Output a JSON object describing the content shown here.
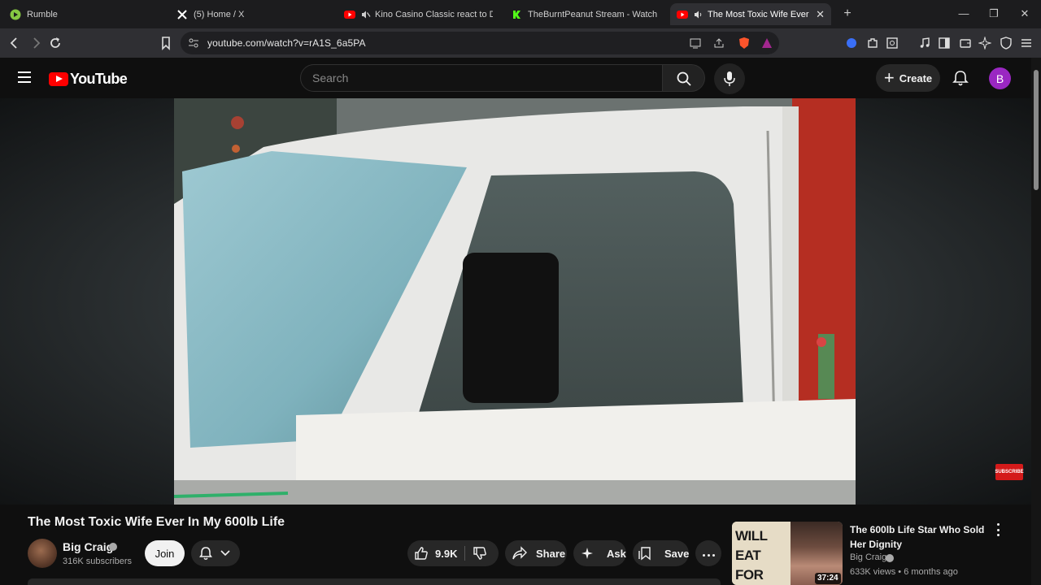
{
  "browser": {
    "tabs": [
      {
        "label": "Rumble",
        "active": false
      },
      {
        "label": "(5) Home / X",
        "active": false
      },
      {
        "label": "Kino Casino Classic react to DSPG",
        "active": false
      },
      {
        "label": "TheBurntPeanut Stream - Watch Live",
        "active": false
      },
      {
        "label": "The Most Toxic Wife Ever In My",
        "active": true
      }
    ],
    "url": "youtube.com/watch?v=rA1S_6a5PA"
  },
  "youtube": {
    "logo_text": "YouTube",
    "search_placeholder": "Search",
    "create_label": "Create",
    "avatar_letter": "B"
  },
  "video": {
    "title": "The Most Toxic Wife Ever In My 600lb Life",
    "channel_name": "Big Craig",
    "subscribers": "316K subscribers",
    "join_label": "Join",
    "likes": "9.9K",
    "share_label": "Share",
    "ask_label": "Ask",
    "save_label": "Save",
    "watermark": "SUBSCRIBE"
  },
  "recommendation": {
    "thumb_text": "WILL EAT FOR MONEY",
    "duration": "37:24",
    "title": "The 600lb Life Star Who Sold Her Dignity",
    "channel": "Big Craig",
    "meta": "633K views • 6 months ago"
  },
  "colors": {
    "accent": "#ff0000",
    "avatar": "#9a27c2",
    "background": "#0f0f0f"
  }
}
